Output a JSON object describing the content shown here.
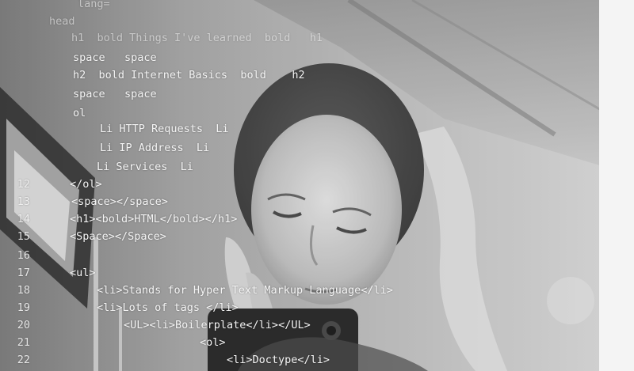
{
  "code_lines": [
    {
      "n": "",
      "text": "lang="
    },
    {
      "n": "",
      "text": "head"
    },
    {
      "n": "",
      "text": "h1  bold Things I've learned  bold   h1"
    },
    {
      "n": "",
      "text": "space   space"
    },
    {
      "n": "",
      "text": "h2  bold Internet Basics  bold    h2"
    },
    {
      "n": "",
      "text": "space   space"
    },
    {
      "n": "",
      "text": "ol"
    },
    {
      "n": "",
      "text": "Li HTTP Requests  Li"
    },
    {
      "n": "",
      "text": "Li IP Address  Li"
    },
    {
      "n": "",
      "text": "Li Services  Li"
    },
    {
      "n": "12",
      "text": "</ol>"
    },
    {
      "n": "13",
      "text": "<space></space>"
    },
    {
      "n": "14",
      "text": "<h1><bold>HTML</bold></h1>"
    },
    {
      "n": "15",
      "text": "<Space></Space>"
    },
    {
      "n": "16",
      "text": ""
    },
    {
      "n": "17",
      "text": "<ul>"
    },
    {
      "n": "18",
      "text": "<li>Stands for Hyper Text Markup Language</li>"
    },
    {
      "n": "19",
      "text": "<li>Lots of tags </li>"
    },
    {
      "n": "20",
      "text": "<UL><li>Boilerplate</li></UL>"
    },
    {
      "n": "21",
      "text": "<ol>"
    },
    {
      "n": "22",
      "text": "<li>Doctype</li>"
    }
  ]
}
